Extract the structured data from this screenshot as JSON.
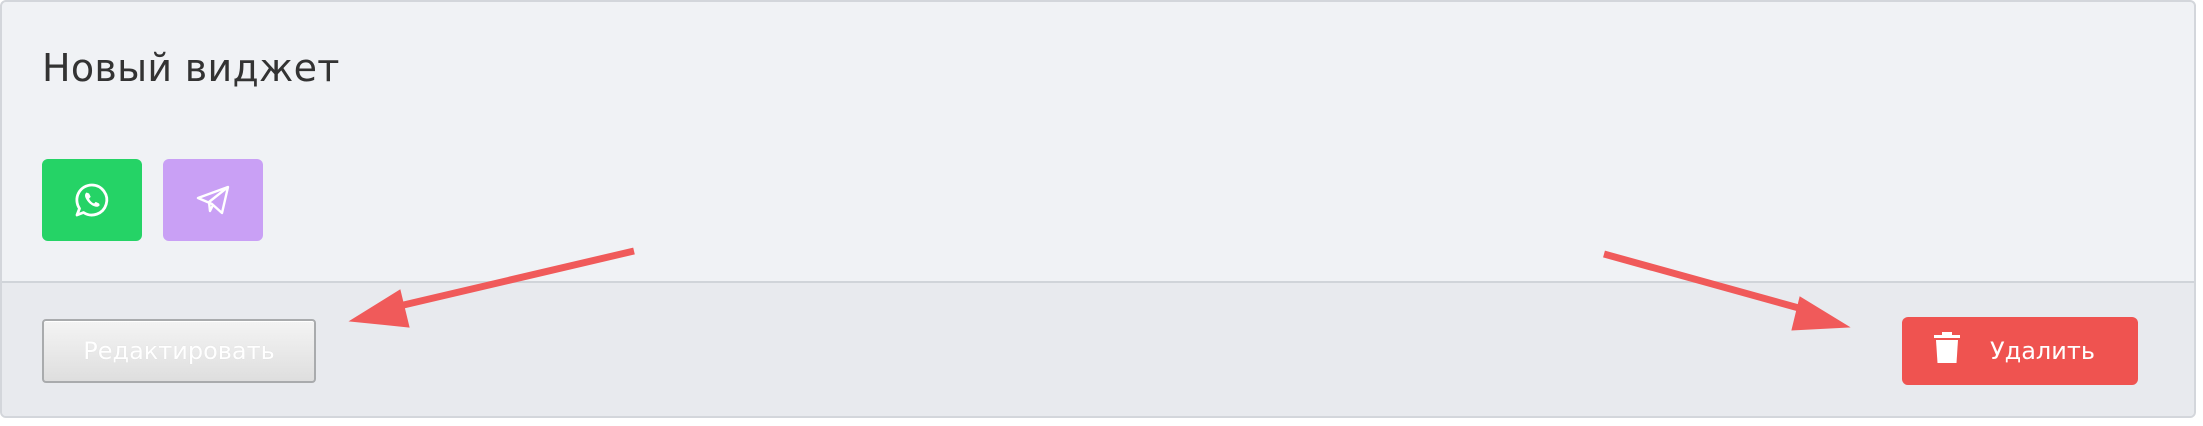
{
  "widget": {
    "title": "Новый виджет",
    "channels": [
      {
        "name": "whatsapp",
        "icon": "whatsapp-icon",
        "color": "#25d366"
      },
      {
        "name": "telegram",
        "icon": "telegram-icon",
        "color": "#c9a0f5"
      }
    ]
  },
  "footer": {
    "edit_label": "Редактировать",
    "delete_label": "Удалить",
    "delete_icon": "trash-icon",
    "delete_color": "#ef5350"
  },
  "annotations": {
    "arrow_color": "#f05a5a"
  }
}
